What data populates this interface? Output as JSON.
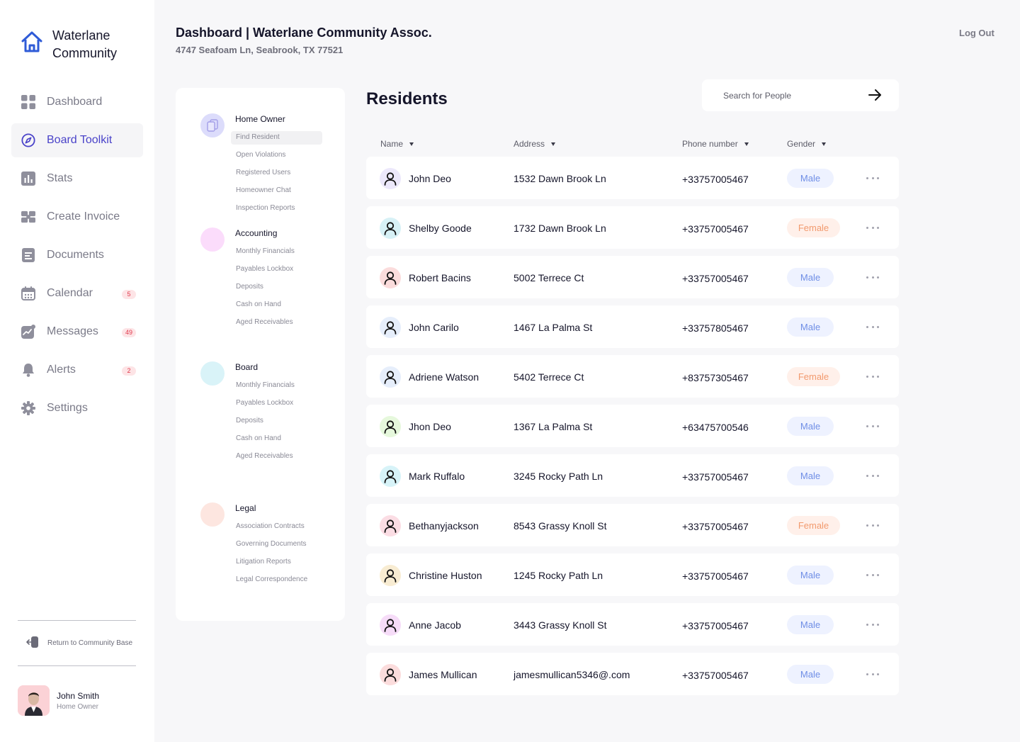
{
  "brand": {
    "name": "Waterlane Community"
  },
  "nav": [
    {
      "label": "Dashboard",
      "icon": "grid-icon",
      "active": false
    },
    {
      "label": "Board Toolkit",
      "icon": "compass-icon",
      "active": true
    },
    {
      "label": "Stats",
      "icon": "bar-chart-icon",
      "active": false
    },
    {
      "label": "Create Invoice",
      "icon": "invoice-icon",
      "active": false
    },
    {
      "label": "Documents",
      "icon": "document-icon",
      "active": false
    },
    {
      "label": "Calendar",
      "icon": "calendar-icon",
      "active": false,
      "badge": "5"
    },
    {
      "label": "Messages",
      "icon": "trend-chat-icon",
      "active": false,
      "badge": "49"
    },
    {
      "label": "Alerts",
      "icon": "bell-icon",
      "active": false,
      "badge": "2"
    },
    {
      "label": "Settings",
      "icon": "gear-icon",
      "active": false
    }
  ],
  "sidebar_footer": {
    "return_label": "Return to Community Base",
    "user_name": "John Smith",
    "user_role": "Home Owner"
  },
  "header": {
    "title": "Dashboard | Waterlane Community Assoc.",
    "address": "4747 Seafoam Ln, Seabrook, TX 77521",
    "logout": "Log Out"
  },
  "toolkit": {
    "groups": [
      {
        "title": "Home Owner",
        "color": "#dcdcfb",
        "items": [
          "Find Resident",
          "Open Violations",
          "Registered Users",
          "Homeowner Chat",
          "Inspection Reports"
        ],
        "selected": 0
      },
      {
        "title": "Accounting",
        "color": "#fbdcfb",
        "items": [
          "Monthly Financials",
          "Payables Lockbox",
          "Deposits",
          "Cash on Hand",
          "Aged Receivables"
        ],
        "selected": -1
      },
      {
        "title": "Board",
        "color": "#d9f3f8",
        "items": [
          "Monthly Financials",
          "Payables Lockbox",
          "Deposits",
          "Cash on Hand",
          "Aged Receivables"
        ],
        "selected": -1
      },
      {
        "title": "Legal",
        "color": "#fde6e0",
        "items": [
          "Association Contracts",
          "Governing Documents",
          "Litigation Reports",
          "Legal Correspondence"
        ],
        "selected": -1
      }
    ]
  },
  "residents": {
    "title": "Residents",
    "search_placeholder": "Search for People",
    "columns": [
      "Name",
      "Address",
      "Phone number",
      "Gender"
    ],
    "rows": [
      {
        "name": "John Deo",
        "address": "1532 Dawn Brook Ln",
        "phone": "+33757005467",
        "gender": "Male",
        "avatar_color": "#ece8fb"
      },
      {
        "name": "Shelby Goode",
        "address": "1732 Dawn Brook Ln",
        "phone": "+33757005467",
        "gender": "Female",
        "avatar_color": "#d7f1f6"
      },
      {
        "name": "Robert Bacins",
        "address": "5002 Terrece Ct",
        "phone": "+33757005467",
        "gender": "Male",
        "avatar_color": "#fbdcdc"
      },
      {
        "name": "John Carilo",
        "address": "1467 La Palma St",
        "phone": "+33757805467",
        "gender": "Male",
        "avatar_color": "#e6eefb"
      },
      {
        "name": "Adriene Watson",
        "address": "5402 Terrece Ct",
        "phone": "+83757305467",
        "gender": "Female",
        "avatar_color": "#e6eefb"
      },
      {
        "name": "Jhon Deo",
        "address": "1367 La Palma St",
        "phone": "+63475700546",
        "gender": "Male",
        "avatar_color": "#e6f8dc"
      },
      {
        "name": "Mark Ruffalo",
        "address": "3245 Rocky Path Ln",
        "phone": "+33757005467",
        "gender": "Male",
        "avatar_color": "#d7f3f8"
      },
      {
        "name": "Bethanyjackson",
        "address": "8543 Grassy Knoll St",
        "phone": "+33757005467",
        "gender": "Female",
        "avatar_color": "#fbdde4"
      },
      {
        "name": "Christine Huston",
        "address": "1245 Rocky Path Ln",
        "phone": "+33757005467",
        "gender": "Male",
        "avatar_color": "#f8ecd2"
      },
      {
        "name": "Anne Jacob",
        "address": "3443 Grassy Knoll St",
        "phone": "+33757005467",
        "gender": "Male",
        "avatar_color": "#f6dcf8"
      },
      {
        "name": "James Mullican",
        "address": "jamesmullican5346@.com",
        "phone": "+33757005467",
        "gender": "Male",
        "avatar_color": "#fbdcdc"
      }
    ]
  }
}
